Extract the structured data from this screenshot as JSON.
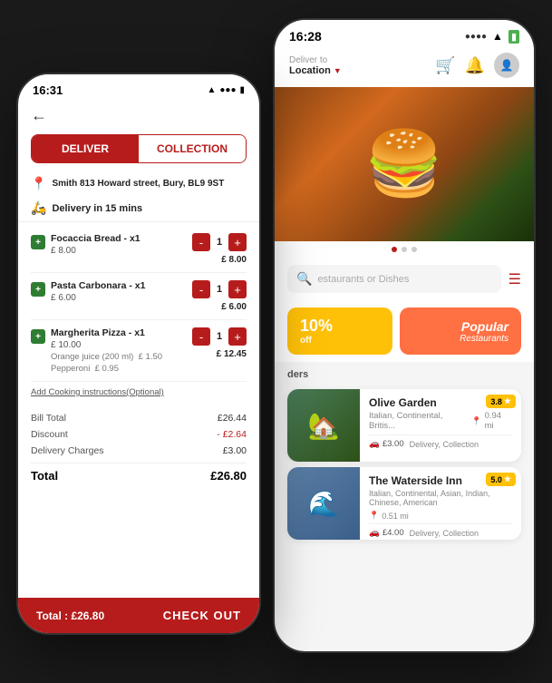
{
  "left_phone": {
    "status_bar": {
      "time": "16:31",
      "wifi": "WiFi",
      "battery": "Battery"
    },
    "tabs": {
      "deliver": "DELIVER",
      "collection": "COLLECTION"
    },
    "address": "Smith 813 Howard street, Bury, BL9 9ST",
    "delivery_time": "Delivery in 15 mins",
    "cart_items": [
      {
        "name": "Focaccia Bread - x1",
        "price": "£ 8.00",
        "qty": 1,
        "total": "£ 8.00"
      },
      {
        "name": "Pasta Carbonara - x1",
        "price": "£ 6.00",
        "qty": 1,
        "total": "£ 6.00"
      },
      {
        "name": "Margherita Pizza - x1",
        "price": "£ 10.00",
        "qty": 1,
        "total": "£ 12.45",
        "extras": [
          "Orange juice (200 ml)  £ 1.50",
          "Pepperoni  £ 0.95"
        ]
      }
    ],
    "cooking_instruction": "Add Cooking instructions(Optional)",
    "bill": {
      "total_label": "Bill Total",
      "total_value": "£26.44",
      "discount_label": "Discount",
      "discount_value": "- £2.64",
      "delivery_label": "Delivery Charges",
      "delivery_value": "£3.00",
      "grand_label": "Total",
      "grand_value": "£26.80"
    },
    "checkout_bar": {
      "total": "Total :  £26.80",
      "button": "CHECK OUT"
    }
  },
  "right_phone": {
    "status_bar": {
      "time": "16:28"
    },
    "header": {
      "deliver_to_label": "Deliver to",
      "cart_icon": "🛒",
      "bell_icon": "🔔"
    },
    "search_placeholder": "estaurants or Dishes",
    "promo": {
      "left_percent": "10%",
      "left_off": "off",
      "right_title": "Popular",
      "right_sub": "Restaurants"
    },
    "section_label": "ders",
    "restaurants": [
      {
        "name": "Olive Garden",
        "cuisine": "Italian, Continental, Britis...",
        "distance": "0.94 mi",
        "delivery_cost": "£3.00",
        "types": "Delivery, Collection",
        "rating": "3.8",
        "emoji": "🏡"
      },
      {
        "name": "The Waterside Inn",
        "cuisine": "Italian, Continental, Asian, Indian, Chinese, American",
        "distance": "0.51 mi",
        "delivery_cost": "£4.00",
        "types": "Delivery, Collection",
        "rating": "5.0",
        "emoji": "🌊"
      }
    ]
  }
}
